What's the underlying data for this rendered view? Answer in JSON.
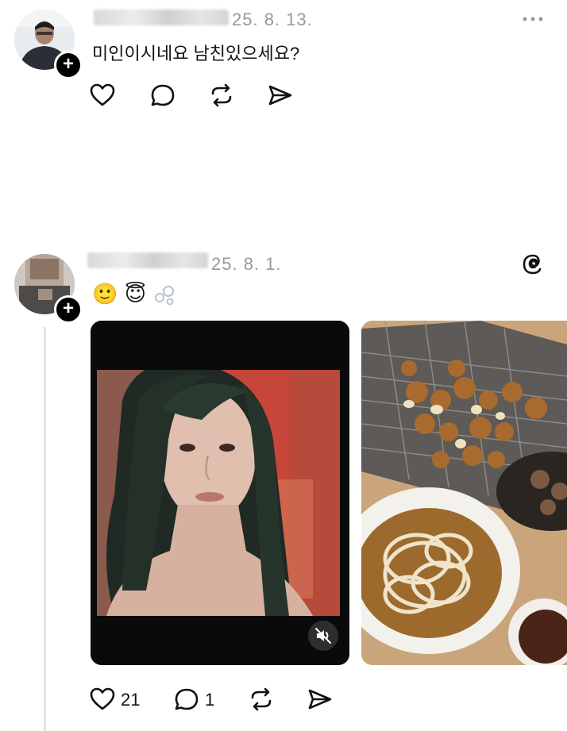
{
  "posts": [
    {
      "date": "25. 8. 13.",
      "text": "미인이시네요 남친있으세요?",
      "more_icon": "more-horizontal-icon"
    },
    {
      "date": "25. 8. 1.",
      "emojis": [
        "🙂",
        "😇"
      ],
      "brand_icon": "threads-logo-icon",
      "likes": "21",
      "comments": "1"
    }
  ],
  "icons": {
    "plus": "+"
  }
}
